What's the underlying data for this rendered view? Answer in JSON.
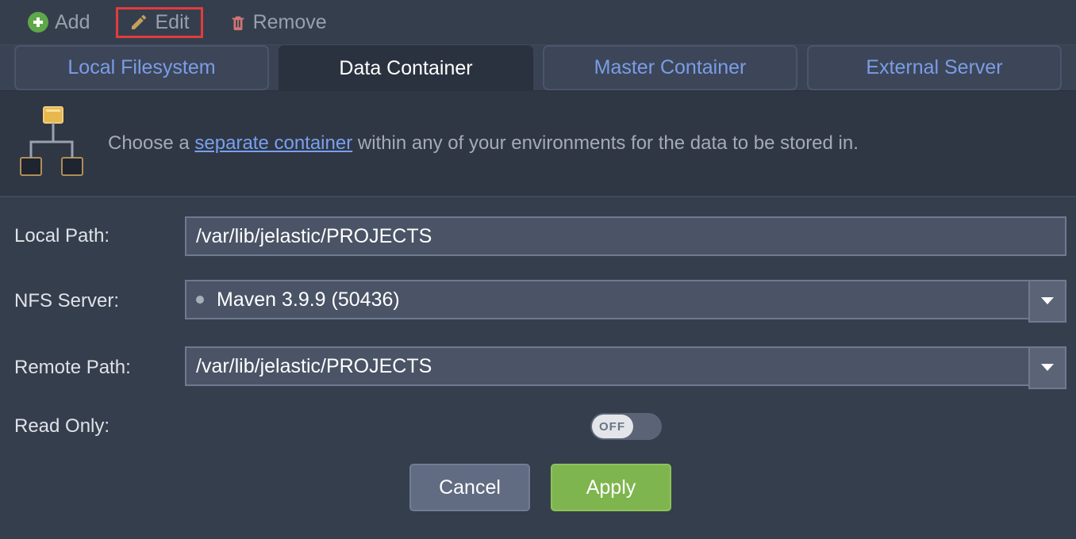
{
  "toolbar": {
    "add": "Add",
    "edit": "Edit",
    "remove": "Remove"
  },
  "tabs": {
    "local": "Local Filesystem",
    "data": "Data Container",
    "master": "Master Container",
    "external": "External Server"
  },
  "desc": {
    "before": "Choose a ",
    "link": "separate container",
    "after": " within any of your environments for the data to be stored in."
  },
  "form": {
    "localPath": {
      "label": "Local Path:",
      "value": "/var/lib/jelastic/PROJECTS"
    },
    "nfsServer": {
      "label": "NFS Server:",
      "value": "Maven 3.9.9 (50436)"
    },
    "remotePath": {
      "label": "Remote Path:",
      "value": "/var/lib/jelastic/PROJECTS"
    },
    "readOnly": {
      "label": "Read Only:",
      "state": "OFF"
    }
  },
  "buttons": {
    "cancel": "Cancel",
    "apply": "Apply"
  }
}
